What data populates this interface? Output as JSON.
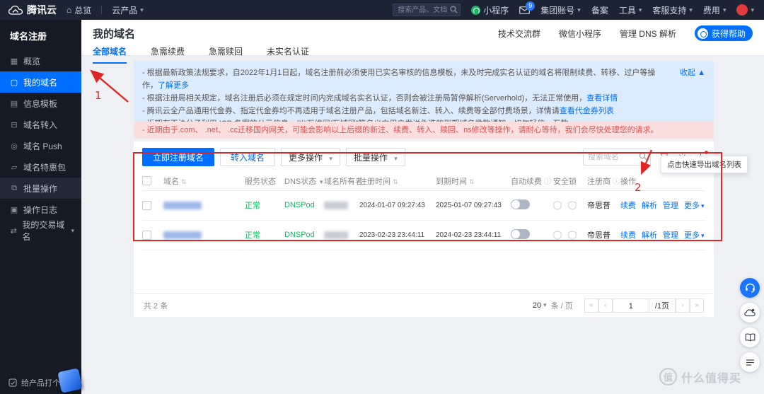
{
  "topbar": {
    "brand": "腾讯云",
    "overview": "总览",
    "products": "云产品",
    "search_placeholder": "搜索产品、文档...",
    "mini_program": "小程序",
    "mail_badge": "9",
    "group_account": "集团账号",
    "beian": "备案",
    "tools": "工具",
    "support": "客服支持",
    "billing": "费用"
  },
  "sidebar": {
    "title": "域名注册",
    "items": [
      {
        "label": "概览",
        "icon": "▦"
      },
      {
        "label": "我的域名",
        "icon": "▢"
      },
      {
        "label": "信息模板",
        "icon": "▤"
      },
      {
        "label": "域名转入",
        "icon": "⊟"
      },
      {
        "label": "域名 Push",
        "icon": "◎"
      },
      {
        "label": "域名特惠包",
        "icon": "▱"
      },
      {
        "label": "批量操作",
        "icon": "⧉"
      },
      {
        "label": "操作日志",
        "icon": "▣"
      },
      {
        "label": "我的交易域名",
        "icon": "⇄"
      }
    ],
    "footer": "给产品打个分"
  },
  "header": {
    "title": "我的域名",
    "links": [
      "技术交流群",
      "微信小程序",
      "管理 DNS 解析"
    ],
    "help_button": "获得帮助",
    "tabs": [
      {
        "label": "全部域名"
      },
      {
        "label": "急需续费"
      },
      {
        "label": "急需赎回"
      },
      {
        "label": "未实名认证"
      }
    ]
  },
  "notice": {
    "collapse": "收起 ▲",
    "lines": [
      {
        "text": "- 根据最新政策法规要求，自2022年1月1日起，域名注册前必须使用已实名审核的信息模板，未及时完成实名认证的域名将限制续费、转移、过户等操作，",
        "link": "了解更多"
      },
      {
        "text": "- 根据注册局相关规定，域名注册后必须在规定时间内完成域名实名认证，否则会被注册局暂停解析(Serverhold)，无法正常使用，",
        "link": "查看详情"
      },
      {
        "text": "- 腾讯云全产品通用代金券、指定代金券均不再适用于域名注册产品，包括域名新注、转入、续费等全部付费场景，详情请",
        "link": "查看代金券列表"
      },
      {
        "text": "- 近期有不法分子利用 ICP 备案的公示信息，以“万维网/万域网”等名义向用户发送伪造的到期域名缴款通知，切勿轻信、汇款。",
        "link": ""
      }
    ]
  },
  "warning": "- 近期由于.com、 .net、 .cc迁移国内网关，可能会影响以上后缀的新注、续费、转入、赎回、ns修改等操作，请耐心等待，我们会尽快处理您的请求。",
  "toolbar": {
    "register": "立即注册域名",
    "transfer": "转入域名",
    "more": "更多操作",
    "batch": "批量操作",
    "search_placeholder": "搜索域名"
  },
  "table": {
    "headers": [
      "域名",
      "服务状态",
      "DNS状态",
      "域名所有者",
      "注册时间",
      "到期时间",
      "自动续费",
      "安全锁",
      "注册商",
      "操作"
    ],
    "rows": [
      {
        "status": "正常",
        "dns": "DNSPod",
        "registered": "2024-01-07 09:27:43",
        "expires": "2025-01-07 09:27:43",
        "registrar": "帝思普",
        "actions": [
          "续费",
          "解析",
          "管理",
          "更多"
        ]
      },
      {
        "status": "正常",
        "dns": "DNSPod",
        "registered": "2023-02-23 23:44:11",
        "expires": "2024-02-23 23:44:11",
        "registrar": "帝思普",
        "actions": [
          "续费",
          "解析",
          "管理",
          "更多"
        ]
      }
    ]
  },
  "tooltip": "点击快速导出域名列表",
  "pagination": {
    "total": "共 2 条",
    "page_size": "20",
    "per_page": "条 / 页",
    "page": "1",
    "total_pages": "/1页",
    "first": "«",
    "prev": "‹",
    "next": "›",
    "last": "»"
  },
  "icons": {
    "caret_down": "▾",
    "sort": "⇅",
    "info": "ⓘ",
    "funnel": "▼",
    "home": "⌂"
  },
  "annotations": {
    "step1": "1",
    "step2": "2"
  },
  "watermark": {
    "logo": "值",
    "text": "什么值得买"
  },
  "colors": {
    "accent": "#006eff",
    "ok_green": "#0abf5b",
    "warn_red": "#e34d4d",
    "annotation_red": "#e12626",
    "topbar_bg": "#1c2433",
    "sidebar_bg": "#161a24"
  }
}
